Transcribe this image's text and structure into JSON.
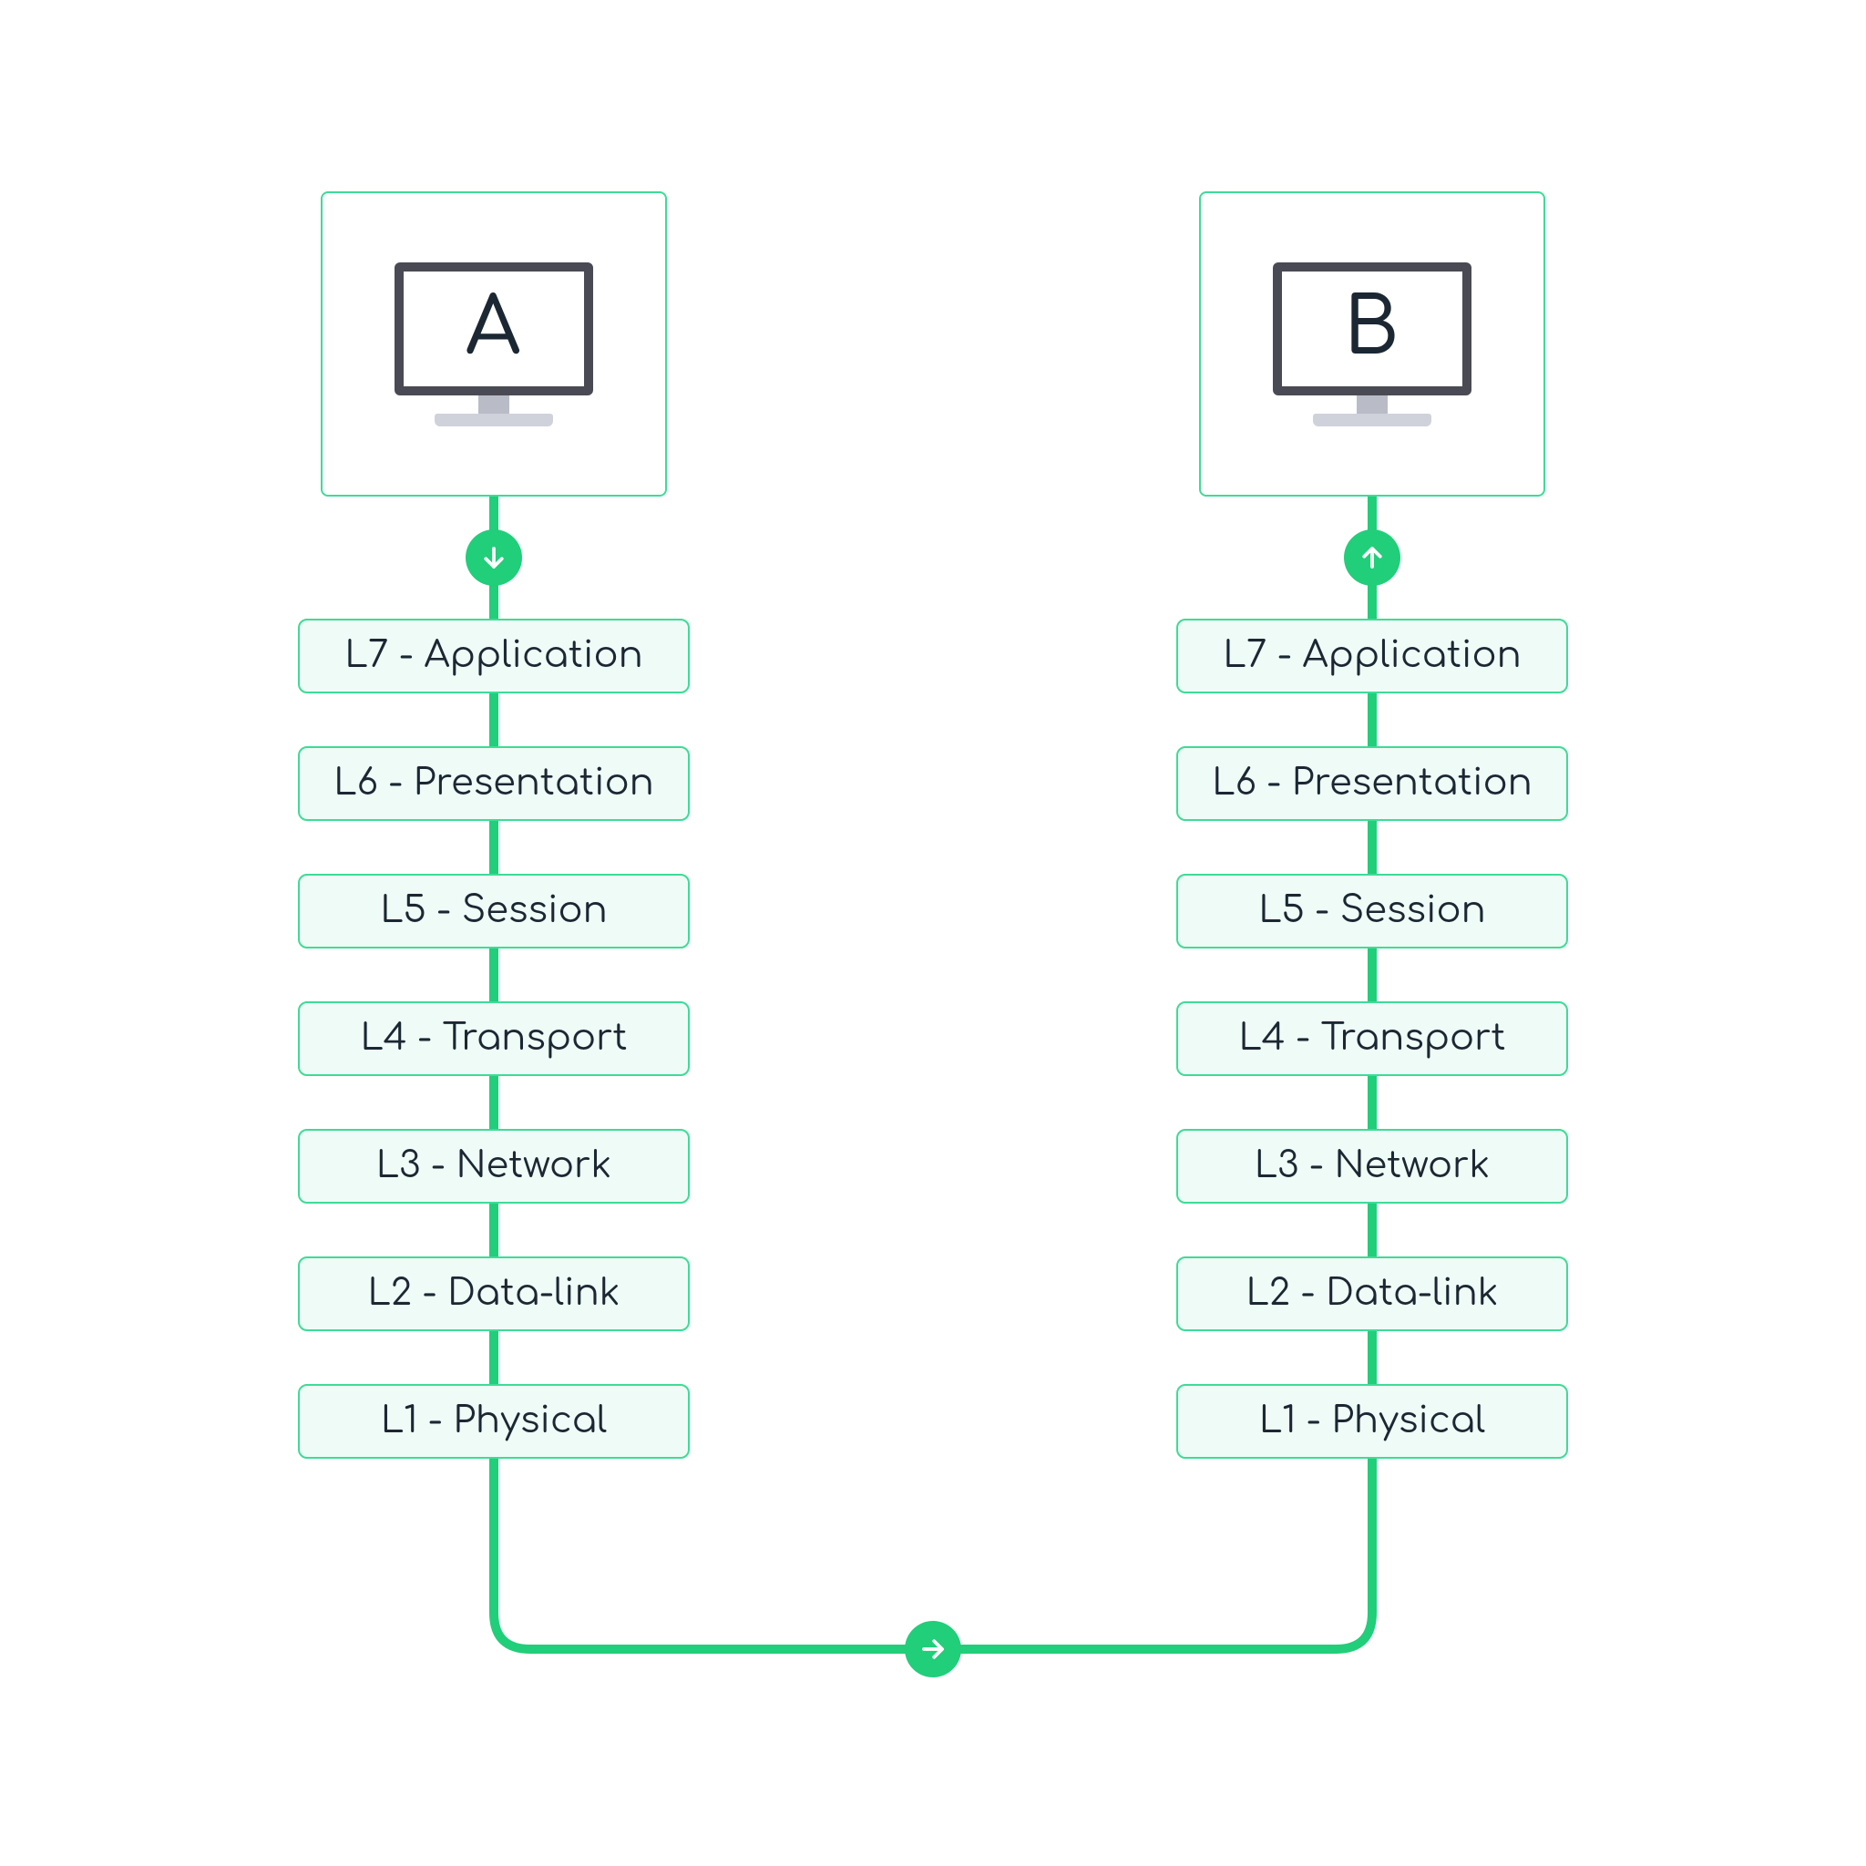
{
  "colors": {
    "accent": "#3DDC97",
    "accentSolid": "#21CE7A",
    "layerFill": "#EFFBF6",
    "text": "#1b2733"
  },
  "nodes": {
    "a": {
      "label": "A",
      "arrowDirection": "down"
    },
    "b": {
      "label": "B",
      "arrowDirection": "up"
    }
  },
  "midArrowDirection": "right",
  "layers": [
    "L7 - Application",
    "L6 - Presentation",
    "L5 - Session",
    "L4 - Transport",
    "L3 - Network",
    "L2 - Data-link",
    "L1 - Physical"
  ]
}
